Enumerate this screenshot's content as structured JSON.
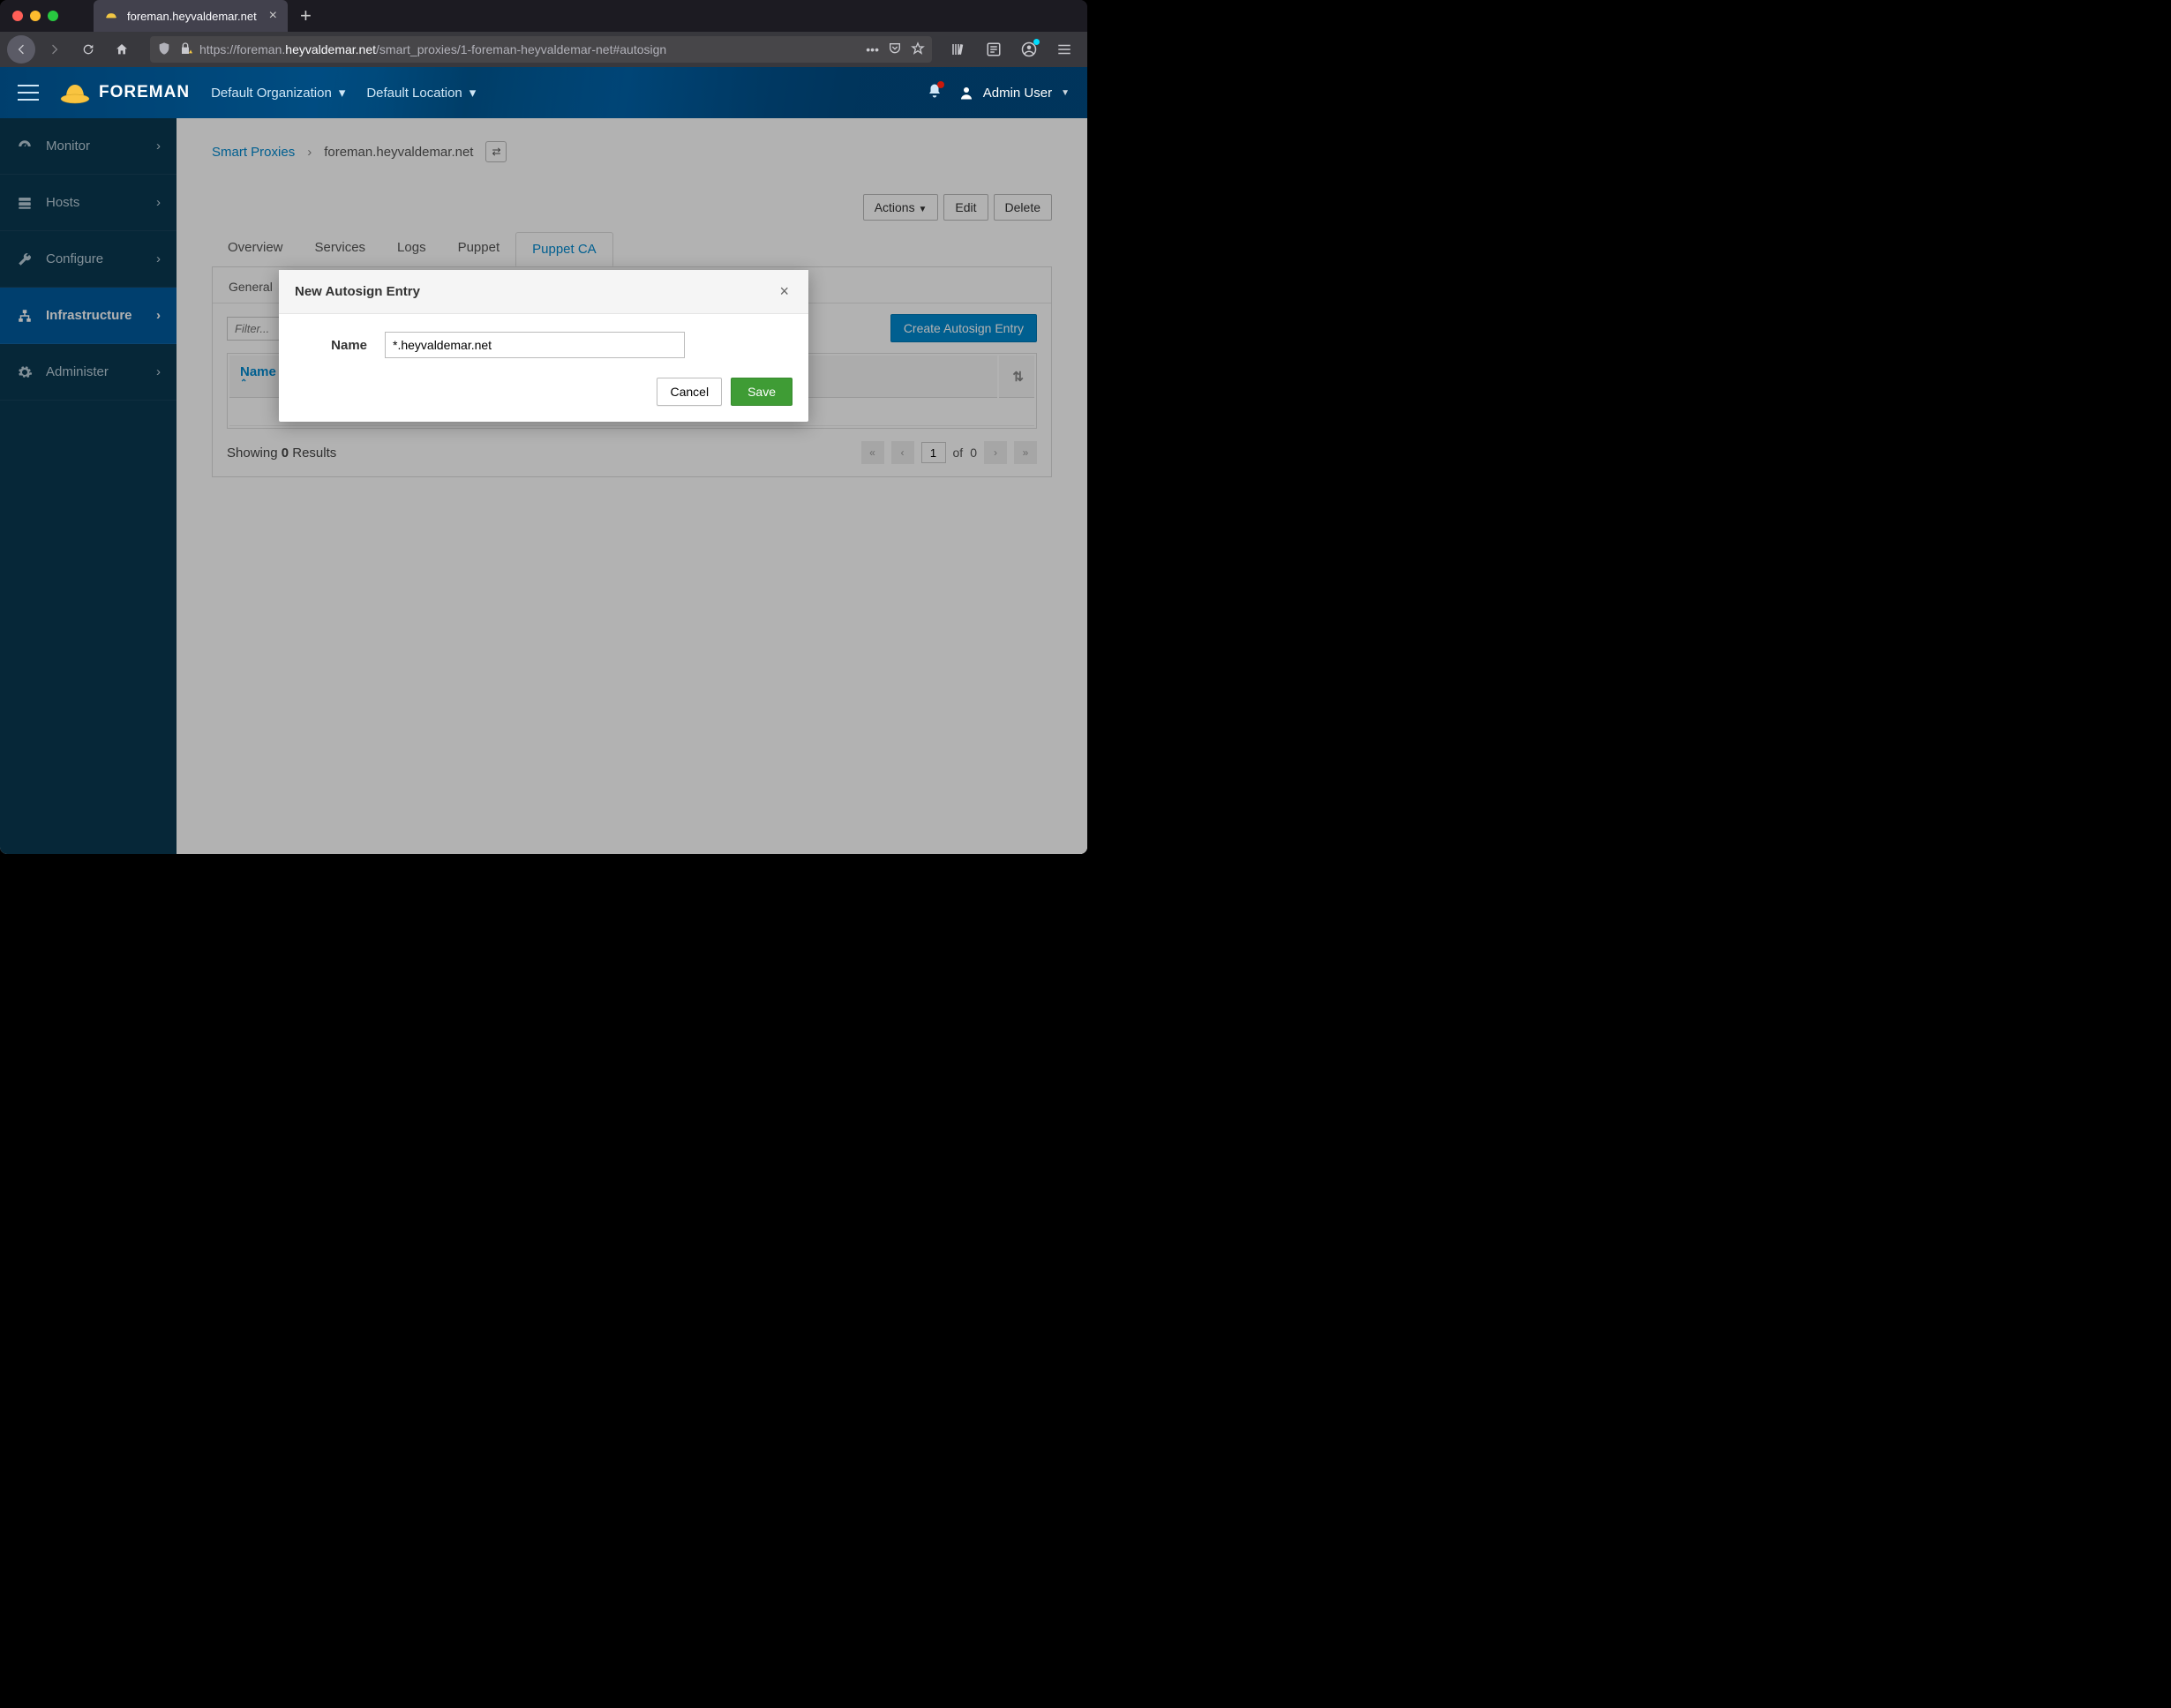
{
  "browser": {
    "tab_title": "foreman.heyvaldemar.net",
    "url_prefix": "https://foreman.",
    "url_host": "heyvaldemar.net",
    "url_path": "/smart_proxies/1-foreman-heyvaldemar-net#autosign"
  },
  "header": {
    "brand": "FOREMAN",
    "org_label": "Default Organization",
    "loc_label": "Default Location",
    "user_name": "Admin User"
  },
  "sidebar": {
    "items": [
      {
        "label": "Monitor"
      },
      {
        "label": "Hosts"
      },
      {
        "label": "Configure"
      },
      {
        "label": "Infrastructure"
      },
      {
        "label": "Administer"
      }
    ]
  },
  "breadcrumb": {
    "root": "Smart Proxies",
    "current": "foreman.heyvaldemar.net"
  },
  "actions": {
    "actions_label": "Actions",
    "edit_label": "Edit",
    "delete_label": "Delete"
  },
  "tabs": {
    "items": [
      "Overview",
      "Services",
      "Logs",
      "Puppet",
      "Puppet CA"
    ],
    "active": "Puppet CA"
  },
  "subtabs": {
    "general": "General"
  },
  "filter": {
    "placeholder": "Filter..."
  },
  "create_btn": "Create Autosign Entry",
  "table": {
    "col_name": "Name"
  },
  "footer": {
    "showing_prefix": "Showing ",
    "count": "0",
    "showing_suffix": " Results",
    "page_input": "1",
    "of_label": "of",
    "total_pages": "0"
  },
  "modal": {
    "title": "New Autosign Entry",
    "name_label": "Name",
    "name_value": "*.heyvaldemar.net",
    "cancel": "Cancel",
    "save": "Save"
  }
}
